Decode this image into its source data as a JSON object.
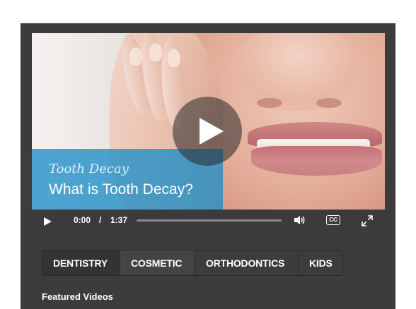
{
  "video": {
    "category": "Tooth Decay",
    "title": "What is Tooth Decay?",
    "current_time": "0:00",
    "time_separator": "/",
    "duration": "1:37",
    "progress_fraction": 0,
    "cc_label": "CC"
  },
  "tabs": [
    {
      "label": "DENTISTRY",
      "active": true
    },
    {
      "label": "COSMETIC",
      "active": false
    },
    {
      "label": "ORTHODONTICS",
      "active": false
    },
    {
      "label": "KIDS",
      "active": false
    }
  ],
  "section": {
    "featured_heading": "Featured Videos"
  },
  "icons": {
    "play": "play-icon",
    "volume": "volume-icon",
    "captions": "closed-captions-icon",
    "fullscreen": "fullscreen-icon"
  },
  "colors": {
    "panel": "#3c3c3c",
    "title_box": "#1e8ec8"
  }
}
